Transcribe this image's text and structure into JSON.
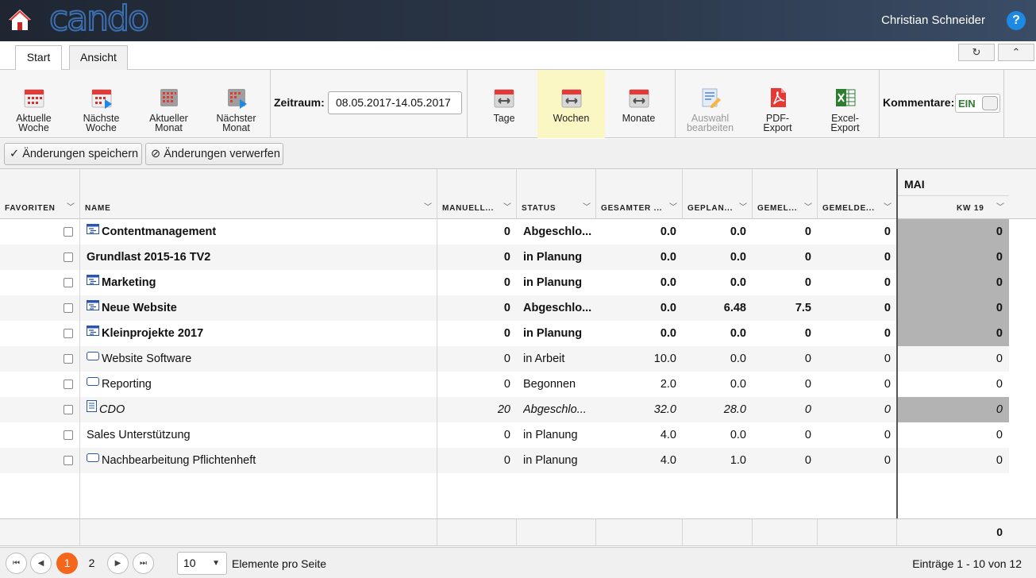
{
  "header": {
    "logo": "cando",
    "user": "Christian Schneider",
    "help": "?"
  },
  "tabs": [
    {
      "label": "Start"
    },
    {
      "label": "Ansicht"
    }
  ],
  "window_buttons": {
    "refresh": "↻",
    "collapse": "⌃"
  },
  "ribbon": {
    "nav": [
      {
        "line1": "Aktuelle",
        "line2": "Woche",
        "icon": "calendar-icon"
      },
      {
        "line1": "Nächste",
        "line2": "Woche",
        "icon": "calendar-next-icon"
      },
      {
        "line1": "Aktueller",
        "line2": "Monat",
        "icon": "calendar-month-icon"
      },
      {
        "line1": "Nächster",
        "line2": "Monat",
        "icon": "calendar-month-next-icon"
      }
    ],
    "zeitraum_label": "Zeitraum:",
    "zeitraum_value": "08.05.2017-14.05.2017",
    "scale": [
      {
        "label": "Tage",
        "selected": false
      },
      {
        "label": "Wochen",
        "selected": true
      },
      {
        "label": "Monate",
        "selected": false
      }
    ],
    "exports": [
      {
        "line1": "Auswahl",
        "line2": "bearbeiten",
        "disabled": true
      },
      {
        "line1": "PDF-",
        "line2": "Export",
        "disabled": false
      },
      {
        "line1": "Excel-",
        "line2": "Export",
        "disabled": false
      }
    ],
    "kommentare_label": "Kommentare:",
    "kommentare_toggle": "EIN"
  },
  "actions": {
    "save": "Änderungen speichern",
    "discard": "Änderungen verwerfen"
  },
  "columns": [
    "FAVORITEN",
    "NAME",
    "MANUELL...",
    "STATUS",
    "GESAMTER ...",
    "GEPLAN...",
    "GEMEL...",
    "GEMELDE..."
  ],
  "month_header": "MAI",
  "week_header": "KW 19",
  "rows": [
    {
      "name": "Contentmanagement",
      "icon": "project",
      "style": "bold",
      "manuell": "0",
      "status": "Abgeschlo...",
      "gesamt": "0.0",
      "geplant": "0.0",
      "gemel": "0",
      "gemelde": "0",
      "kw": "0",
      "kw_gray": true
    },
    {
      "name": "Grundlast 2015-16 TV2",
      "icon": "none",
      "style": "bold",
      "manuell": "0",
      "status": "in Planung",
      "gesamt": "0.0",
      "geplant": "0.0",
      "gemel": "0",
      "gemelde": "0",
      "kw": "0",
      "kw_gray": true
    },
    {
      "name": "Marketing",
      "icon": "project",
      "style": "bold",
      "manuell": "0",
      "status": "in Planung",
      "gesamt": "0.0",
      "geplant": "0.0",
      "gemel": "0",
      "gemelde": "0",
      "kw": "0",
      "kw_gray": true
    },
    {
      "name": "Neue Website",
      "icon": "project",
      "style": "bold",
      "manuell": "0",
      "status": "Abgeschlo...",
      "gesamt": "0.0",
      "geplant": "6.48",
      "gemel": "7.5",
      "gemelde": "0",
      "kw": "0",
      "kw_gray": true
    },
    {
      "name": "Kleinprojekte 2017",
      "icon": "project",
      "style": "bold",
      "manuell": "0",
      "status": "in Planung",
      "gesamt": "0.0",
      "geplant": "0.0",
      "gemel": "0",
      "gemelde": "0",
      "kw": "0",
      "kw_gray": true
    },
    {
      "name": "Website Software",
      "icon": "task",
      "style": "normal",
      "manuell": "0",
      "status": "in Arbeit",
      "gesamt": "10.0",
      "geplant": "0.0",
      "gemel": "0",
      "gemelde": "0",
      "kw": "0",
      "kw_gray": false
    },
    {
      "name": "Reporting",
      "icon": "task",
      "style": "normal",
      "manuell": "0",
      "status": "Begonnen",
      "gesamt": "2.0",
      "geplant": "0.0",
      "gemel": "0",
      "gemelde": "0",
      "kw": "0",
      "kw_gray": false
    },
    {
      "name": "CDO",
      "icon": "doc",
      "style": "italic",
      "manuell": "20",
      "status": "Abgeschlo...",
      "gesamt": "32.0",
      "geplant": "28.0",
      "gemel": "0",
      "gemelde": "0",
      "kw": "0",
      "kw_gray": true
    },
    {
      "name": "Sales Unterstützung",
      "icon": "none",
      "style": "normal",
      "manuell": "0",
      "status": "in Planung",
      "gesamt": "4.0",
      "geplant": "0.0",
      "gemel": "0",
      "gemelde": "0",
      "kw": "0",
      "kw_gray": false
    },
    {
      "name": "Nachbearbeitung Pflichtenheft",
      "icon": "task",
      "style": "normal",
      "manuell": "0",
      "status": "in Planung",
      "gesamt": "4.0",
      "geplant": "1.0",
      "gemel": "0",
      "gemelde": "0",
      "kw": "0",
      "kw_gray": false
    }
  ],
  "summary_total": "0",
  "pager": {
    "pages": [
      "1",
      "2"
    ],
    "current_page": "1",
    "page_size": "10",
    "page_size_label": "Elemente pro Seite",
    "entries": "Einträge 1 - 10 von 12"
  },
  "colors": {
    "accent": "#f4661b",
    "selected_ribbon": "#fbf7c4",
    "help": "#1e88e5"
  }
}
